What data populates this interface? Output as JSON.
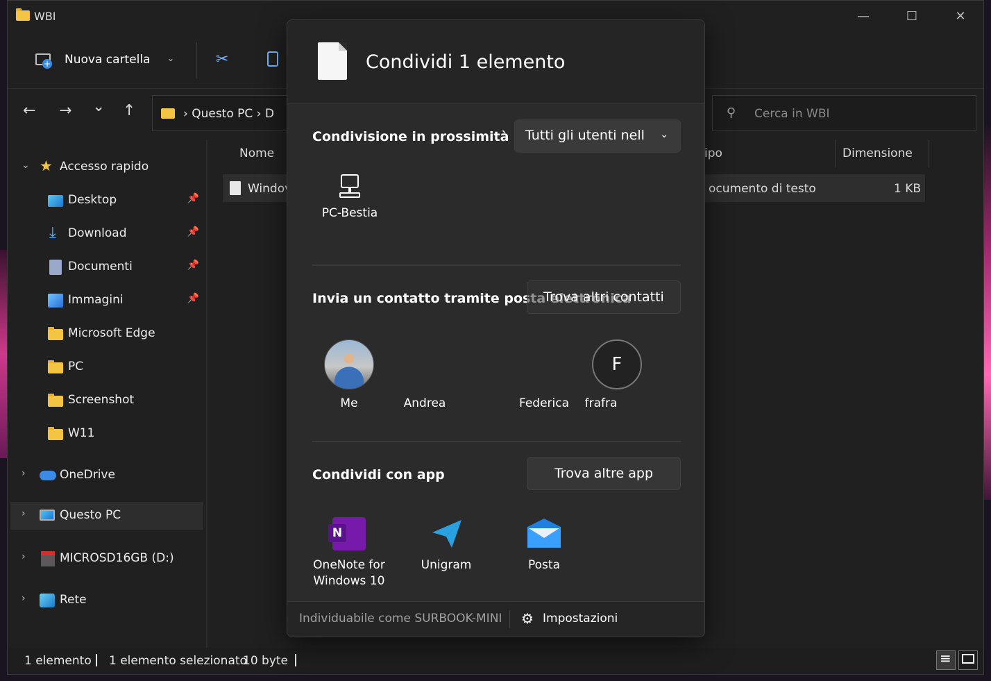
{
  "window": {
    "title": "WBI",
    "controls": {
      "minimize": "—",
      "maximize": "☐",
      "close": "✕"
    }
  },
  "toolbar": {
    "new_folder_label": "Nuova cartella",
    "new_folder_icon": "new-folder-icon",
    "cut_icon": "scissors-icon",
    "copy_icon": "copy-icon"
  },
  "nav": {
    "back": "←",
    "forward": "→",
    "recent": "⌄",
    "up": "↑",
    "address_path": "›  Questo PC  ›  D",
    "search_placeholder": "Cerca in WBI"
  },
  "sidebar": {
    "quick_access": "Accesso rapido",
    "items": [
      {
        "label": "Desktop",
        "icon": "desktop-icon",
        "pinned": true
      },
      {
        "label": "Download",
        "icon": "download-icon",
        "pinned": true
      },
      {
        "label": "Documenti",
        "icon": "documents-icon",
        "pinned": true
      },
      {
        "label": "Immagini",
        "icon": "pictures-icon",
        "pinned": true
      },
      {
        "label": "Microsoft Edge",
        "icon": "folder-icon",
        "pinned": false
      },
      {
        "label": "PC",
        "icon": "folder-icon",
        "pinned": false
      },
      {
        "label": "Screenshot",
        "icon": "folder-icon",
        "pinned": false
      },
      {
        "label": "W11",
        "icon": "folder-icon",
        "pinned": false
      }
    ],
    "roots": [
      {
        "label": "OneDrive",
        "icon": "onedrive-icon"
      },
      {
        "label": "Questo PC",
        "icon": "this-pc-icon",
        "selected": true
      },
      {
        "label": "MICROSD16GB (D:)",
        "icon": "sd-card-icon"
      },
      {
        "label": "Rete",
        "icon": "network-icon"
      }
    ]
  },
  "content": {
    "columns": {
      "name": "Nome",
      "type": "Tipo",
      "size": "Dimensione"
    },
    "type_visible": "ipo",
    "file": {
      "name": "Windov",
      "type": "Documento di testo",
      "type_visible": "ocumento di testo",
      "size": "1 KB"
    }
  },
  "status": {
    "count": "1 elemento",
    "selected": "1 elemento selezionato",
    "size": "10 byte"
  },
  "share": {
    "title": "Condividi 1 elemento",
    "nearby": {
      "title": "Condivisione in prossimità",
      "dropdown_value": "Tutti gli utenti nell",
      "devices": [
        {
          "name": "PC-Bestia",
          "icon": "computer-icon"
        }
      ]
    },
    "contacts": {
      "title": "Invia un contatto tramite posta elettronica",
      "find_button": "Trova altri contatti",
      "people": [
        {
          "name": "Me",
          "avatar": "photo"
        },
        {
          "name": "Andrea",
          "avatar": "none"
        },
        {
          "name": "Federica",
          "avatar": "none"
        },
        {
          "name": "frafra",
          "avatar": "F"
        }
      ]
    },
    "apps": {
      "title": "Condividi con app",
      "find_button": "Trova altre app",
      "list": [
        {
          "name_line1": "OneNote for",
          "name_line2": "Windows 10",
          "icon": "onenote-icon",
          "color": "#7719aa"
        },
        {
          "name_line1": "Unigram",
          "name_line2": "",
          "icon": "unigram-icon",
          "color": "#2aa1e0"
        },
        {
          "name_line1": "Posta",
          "name_line2": "",
          "icon": "mail-icon",
          "color": "#1e90ff"
        }
      ]
    },
    "footer": {
      "discoverable": "Individuabile come SURBOOK-MINI",
      "settings": "Impostazioni",
      "settings_icon": "gear-icon"
    }
  }
}
